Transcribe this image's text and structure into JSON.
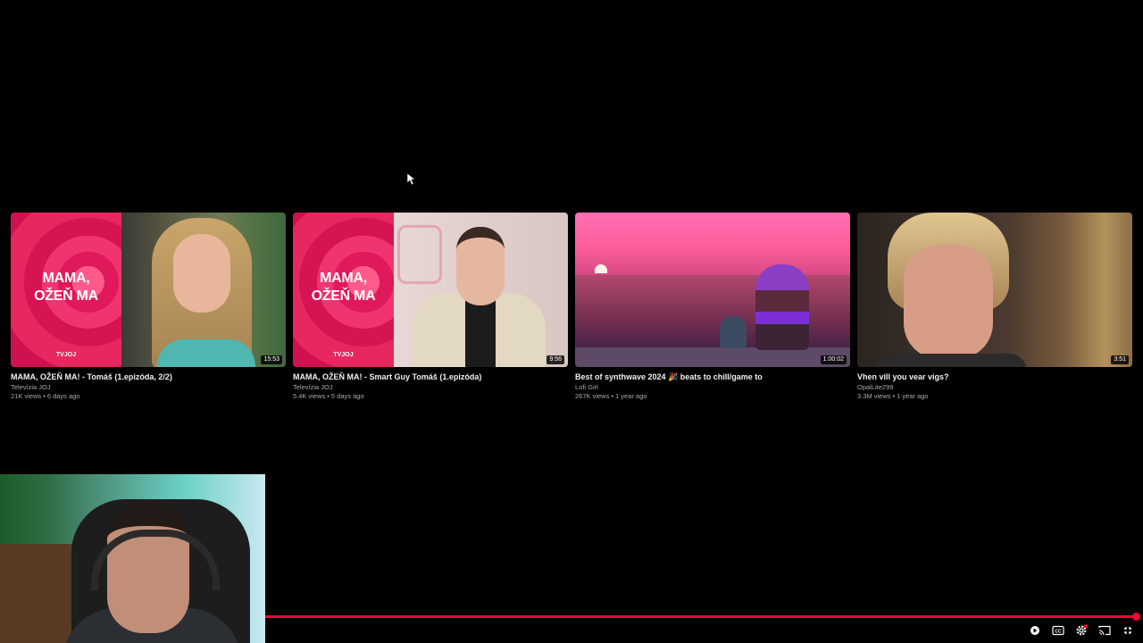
{
  "videos": [
    {
      "title": "MAMA, OŽEŇ MA! - Tomáš (1.epizóda, 2/2)",
      "channel": "Televízia JOJ",
      "views": "21K views",
      "age": "6 days ago",
      "duration": "15:53",
      "show_logo_line1": "MAMA,",
      "show_logo_line2": "OŽEŇ MA",
      "network_logo": "TVJOJ"
    },
    {
      "title": "MAMA, OŽEŇ MA! - Smart Guy Tomáš (1.epizóda)",
      "channel": "Televízia JOJ",
      "views": "5.4K views",
      "age": "5 days ago",
      "duration": "9:56",
      "show_logo_line1": "MAMA,",
      "show_logo_line2": "OŽEŇ MA",
      "network_logo": "TVJOJ"
    },
    {
      "title": "Best of synthwave 2024 🎉 beats to chill/game to",
      "channel": "Lofi Girl",
      "views": "267K views",
      "age": "1 year ago",
      "duration": "1:00:02"
    },
    {
      "title": "Vhen vill you vear vigs?",
      "channel": "OpalLite299",
      "views": "3.3M views",
      "age": "1 year ago",
      "duration": "3:51"
    }
  ],
  "meta_separator": "•",
  "player": {
    "progress": 0.998,
    "controls": [
      "autoplay-toggle-icon",
      "captions-icon",
      "settings-icon",
      "cast-icon",
      "exit-fullscreen-icon"
    ],
    "accent_color": "#ff0033",
    "captions_label": "CC"
  },
  "colors": {
    "background": "#000000",
    "title_text": "#f1f1f1",
    "meta_text": "#aaaaaa",
    "tvjoj_pink": "#e0195a"
  }
}
